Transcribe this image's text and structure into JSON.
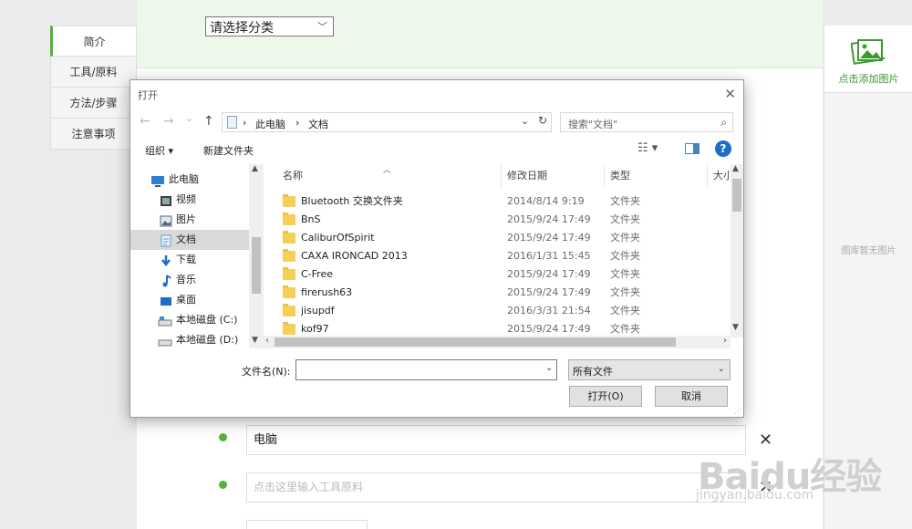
{
  "category_select": {
    "value": "请选择分类"
  },
  "left_nav": {
    "items": [
      {
        "label": "简介",
        "active": true
      },
      {
        "label": "工具/原料"
      },
      {
        "label": "方法/步骤"
      },
      {
        "label": "注意事项"
      }
    ]
  },
  "right_panel": {
    "add_image_label": "点击添加图片",
    "empty_label": "图库暂无图片"
  },
  "form": {
    "tool_item_value": "电脑",
    "tool_placeholder": "点击这里输入工具原料",
    "close_glyph": "✕"
  },
  "watermark": {
    "big": "Baidu经验",
    "small": "jingyan.baidu.com"
  },
  "dialog": {
    "title": "打开",
    "close_glyph": "✕",
    "nav": {
      "back": "←",
      "forward": "→",
      "recent": "⌄",
      "up": "↑"
    },
    "breadcrumb": [
      "此电脑",
      "文档"
    ],
    "breadcrumb_sep": "›",
    "search_placeholder": "搜索\"文档\"",
    "toolbar": {
      "organize": "组织 ▾",
      "new_folder": "新建文件夹",
      "help": "?"
    },
    "tree": [
      {
        "label": "此电脑",
        "icon": "computer-icon"
      },
      {
        "label": "视频",
        "icon": "video-icon"
      },
      {
        "label": "图片",
        "icon": "pictures-icon"
      },
      {
        "label": "文档",
        "icon": "documents-icon",
        "selected": true
      },
      {
        "label": "下载",
        "icon": "download-icon"
      },
      {
        "label": "音乐",
        "icon": "music-icon"
      },
      {
        "label": "桌面",
        "icon": "desktop-icon"
      },
      {
        "label": "本地磁盘 (C:)",
        "icon": "drive-icon"
      },
      {
        "label": "本地磁盘 (D:)",
        "icon": "drive-icon"
      }
    ],
    "columns": {
      "name": "名称",
      "date": "修改日期",
      "type": "类型",
      "size": "大小"
    },
    "files": [
      {
        "name": "Bluetooth 交换文件夹",
        "date": "2014/8/14 9:19",
        "type": "文件夹"
      },
      {
        "name": "BnS",
        "date": "2015/9/24 17:49",
        "type": "文件夹"
      },
      {
        "name": "CaliburOfSpirit",
        "date": "2015/9/24 17:49",
        "type": "文件夹"
      },
      {
        "name": "CAXA IRONCAD 2013",
        "date": "2016/1/31 15:45",
        "type": "文件夹"
      },
      {
        "name": "C-Free",
        "date": "2015/9/24 17:49",
        "type": "文件夹"
      },
      {
        "name": "firerush63",
        "date": "2015/9/24 17:49",
        "type": "文件夹"
      },
      {
        "name": "jisupdf",
        "date": "2016/3/31 21:54",
        "type": "文件夹"
      },
      {
        "name": "kof97",
        "date": "2015/9/24 17:49",
        "type": "文件夹"
      }
    ],
    "filename_label": "文件名(N):",
    "filename_value": "",
    "filetype_value": "所有文件",
    "open_button": "打开(O)",
    "cancel_button": "取消"
  }
}
